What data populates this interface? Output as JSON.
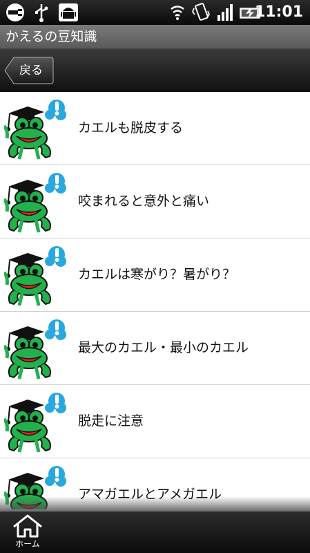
{
  "status_bar": {
    "time": "11:01",
    "icons": [
      "usb-plug-icon",
      "usb-icon",
      "android-debug-icon",
      "wifi-icon",
      "vibrate-icon",
      "signal-icon",
      "battery-charging-icon"
    ]
  },
  "title_bar": {
    "title": "かえるの豆知識"
  },
  "nav": {
    "back_label": "戻る",
    "back_icon": "back-arrow-icon"
  },
  "list": {
    "items": [
      {
        "label": "カエルも脱皮する",
        "icon": "frog-graduate-icon"
      },
      {
        "label": "咬まれると意外と痛い",
        "icon": "frog-graduate-icon"
      },
      {
        "label": "カエルは寒がり？暑がり？",
        "icon": "frog-graduate-icon"
      },
      {
        "label": "最大のカエル・最小のカエル",
        "icon": "frog-graduate-icon"
      },
      {
        "label": "脱走に注意",
        "icon": "frog-graduate-icon"
      },
      {
        "label": "アマガエルとアメガエル",
        "icon": "frog-graduate-icon"
      }
    ]
  },
  "tab_bar": {
    "home_label": "ホーム",
    "home_icon": "home-icon"
  },
  "colors": {
    "frog_green": "#22b14c",
    "bubble_blue": "#29a8e0",
    "mouth_red": "#e52222"
  }
}
